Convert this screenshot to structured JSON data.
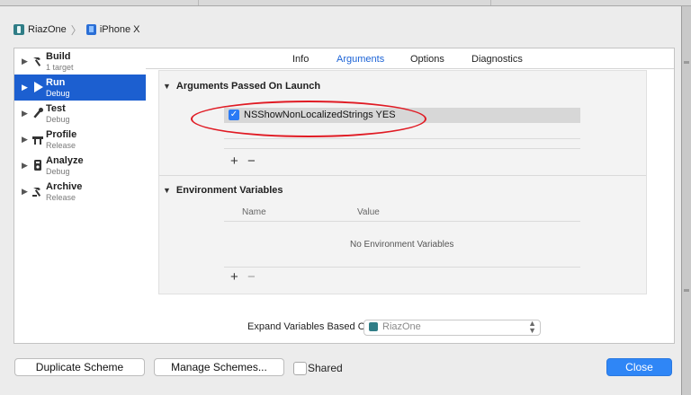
{
  "breadcrumb": {
    "project": "RiazOne",
    "device": "iPhone X"
  },
  "sidebar": {
    "items": [
      {
        "name": "Build",
        "sub": "1 target",
        "icon": "hammer-icon"
      },
      {
        "name": "Run",
        "sub": "Debug",
        "icon": "play-icon"
      },
      {
        "name": "Test",
        "sub": "Debug",
        "icon": "wrench-icon"
      },
      {
        "name": "Profile",
        "sub": "Release",
        "icon": "instruments-icon"
      },
      {
        "name": "Analyze",
        "sub": "Debug",
        "icon": "analyze-icon"
      },
      {
        "name": "Archive",
        "sub": "Release",
        "icon": "archive-icon"
      }
    ],
    "selected": "Run"
  },
  "tabs": {
    "items": [
      "Info",
      "Arguments",
      "Options",
      "Diagnostics"
    ],
    "active": "Arguments"
  },
  "arguments": {
    "title": "Arguments Passed On Launch",
    "entries": [
      {
        "checked": true,
        "value": "NSShowNonLocalizedStrings YES"
      }
    ],
    "add": "+",
    "remove": "−"
  },
  "environment": {
    "title": "Environment Variables",
    "col_name": "Name",
    "col_value": "Value",
    "empty": "No Environment Variables",
    "add": "+",
    "remove": "−"
  },
  "expand": {
    "label": "Expand Variables Based On",
    "value": "RiazOne"
  },
  "footer": {
    "duplicate": "Duplicate Scheme",
    "manage": "Manage Schemes...",
    "shared": "Shared",
    "shared_checked": false,
    "close": "Close"
  },
  "colors": {
    "accent": "#1c5fd0",
    "annotation": "#e01b24",
    "close_button": "#2f86f6"
  }
}
